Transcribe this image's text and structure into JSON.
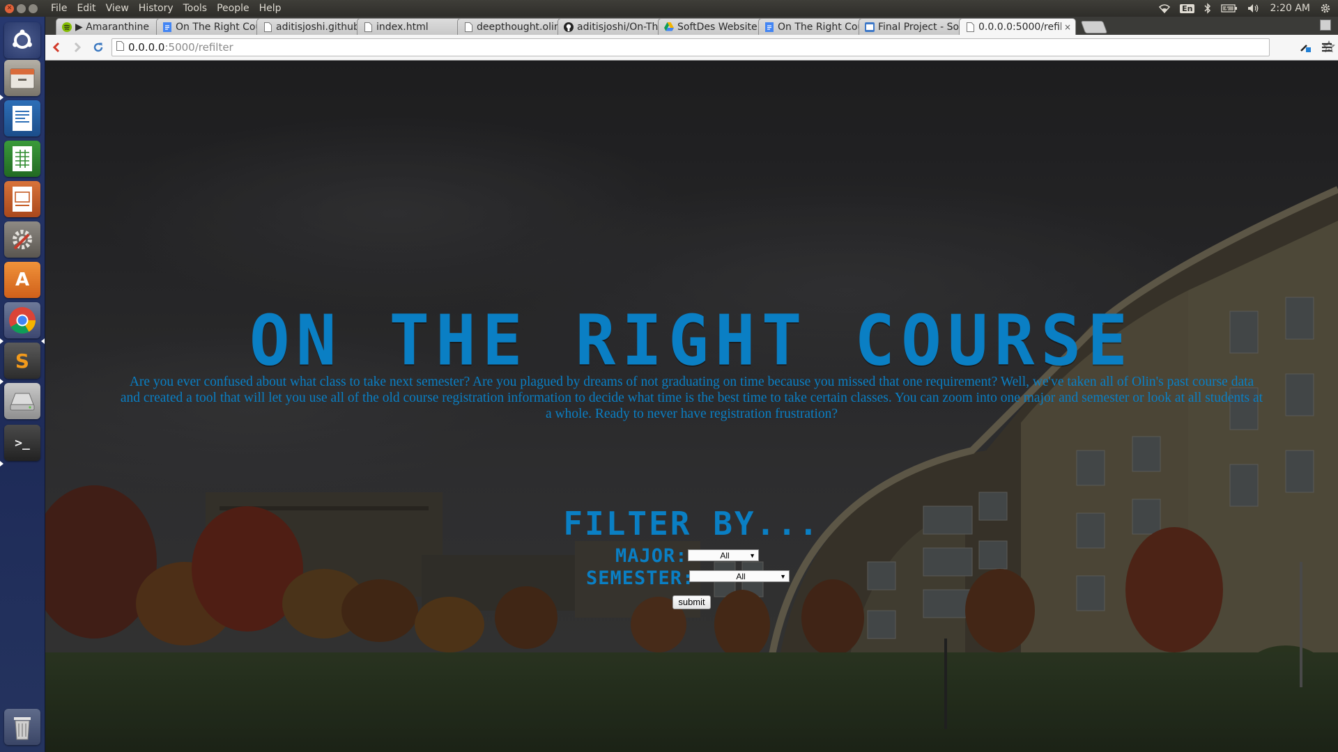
{
  "system": {
    "menu": [
      "File",
      "Edit",
      "View",
      "History",
      "Tools",
      "People",
      "Help"
    ],
    "keyboard_layout": "En",
    "clock": "2:20 AM",
    "tray_icons": [
      "wifi-icon",
      "keyboard-layout-icon",
      "bluetooth-icon",
      "battery-icon",
      "volume-icon",
      "power-gear-icon"
    ]
  },
  "launcher": {
    "apps": [
      "dash-icon",
      "files-icon",
      "writer-icon",
      "calc-icon",
      "impress-icon",
      "system-settings-icon",
      "software-center-icon",
      "chrome-icon",
      "sublime-text-icon",
      "disk-icon",
      "terminal-icon",
      "trash-icon"
    ],
    "software_center_glyph": "A",
    "sublime_glyph": "S",
    "terminal_glyph": ">_"
  },
  "browser": {
    "tabs": [
      {
        "title": "▶ Amaranthine",
        "icon": "spotify-icon",
        "audio": "◂)"
      },
      {
        "title": "On The Right Cour",
        "icon": "docs-icon"
      },
      {
        "title": "aditisjoshi.github",
        "icon": "page-icon"
      },
      {
        "title": "index.html",
        "icon": "page-icon"
      },
      {
        "title": "deepthought.olin",
        "icon": "page-icon"
      },
      {
        "title": "aditisjoshi/On-Th",
        "icon": "github-icon"
      },
      {
        "title": "SoftDes Website",
        "icon": "drive-icon"
      },
      {
        "title": "On The Right Cour",
        "icon": "docs-icon"
      },
      {
        "title": "Final Project - Soft",
        "icon": "site-icon"
      },
      {
        "title": "0.0.0.0:5000/refilt",
        "icon": "page-icon",
        "active": true
      }
    ],
    "close_glyph": "×",
    "url_host": "0.0.0.0",
    "url_path": ":5000/refilter"
  },
  "page": {
    "title": "ON THE RIGHT COURSE",
    "intro": "Are you ever confused about what class to take next semester? Are you plagued by dreams of not graduating on time because you missed that one requirement? Well, we've taken all of Olin's past course data and created a tool that will let you use all of the old course registration information to decide what time is the best time to take certain classes. You can zoom into one major and semester or look at all students at a whole. Ready to never have registration frustration?",
    "filter_heading": "FILTER BY...",
    "major_label": "MAJOR:",
    "major_value": "All",
    "semester_label": "SEMESTER:",
    "semester_value": "All",
    "submit_label": "submit"
  },
  "colors": {
    "accent": "#0a7fc4",
    "panel": "#3c3b37",
    "launcher": "#233366"
  }
}
